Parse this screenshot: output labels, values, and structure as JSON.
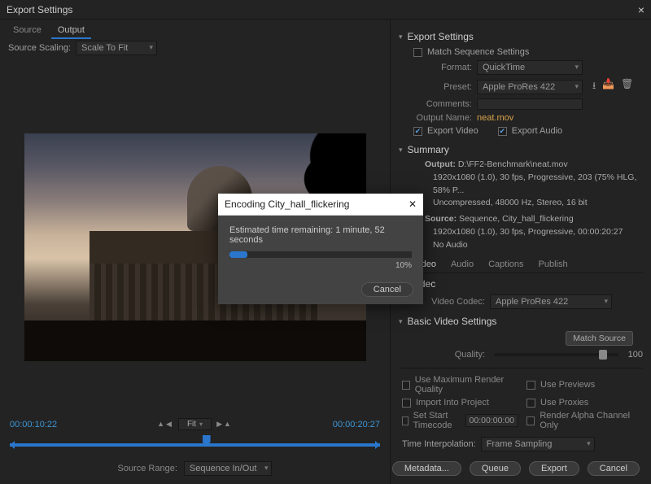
{
  "window": {
    "title": "Export Settings"
  },
  "left": {
    "tabs": [
      "Source",
      "Output"
    ],
    "active_tab": 1,
    "scaling_label": "Source Scaling:",
    "scaling_value": "Scale To Fit",
    "time_in": "00:00:10:22",
    "time_out": "00:00:20:27",
    "fit_label": "Fit",
    "source_range_label": "Source Range:",
    "source_range_value": "Sequence In/Out"
  },
  "export": {
    "heading": "Export Settings",
    "match_seq": "Match Sequence Settings",
    "format_label": "Format:",
    "format_value": "QuickTime",
    "preset_label": "Preset:",
    "preset_value": "Apple ProRes 422",
    "comments_label": "Comments:",
    "outputname_label": "Output Name:",
    "outputname_value": "neat.mov",
    "export_video": "Export Video",
    "export_audio": "Export Audio"
  },
  "summary": {
    "heading": "Summary",
    "output_label": "Output:",
    "output_path": "D:\\FF2-Benchmark\\neat.mov",
    "output_line2": "1920x1080 (1.0), 30 fps, Progressive, 203 (75% HLG, 58% P...",
    "output_line3": "Uncompressed, 48000 Hz, Stereo, 16 bit",
    "source_label": "Source:",
    "source_line1": "Sequence, City_hall_flickering",
    "source_line2": "1920x1080 (1.0), 30 fps, Progressive, 00:00:20:27",
    "source_line3": "No Audio"
  },
  "subtabs": {
    "items": [
      "Video",
      "Audio",
      "Captions",
      "Publish"
    ],
    "active": 0
  },
  "codec": {
    "heading": "Codec",
    "label": "Video Codec:",
    "value": "Apple ProRes 422"
  },
  "basic": {
    "heading": "Basic Video Settings",
    "match_source": "Match Source",
    "quality_label": "Quality:",
    "quality_value": "100"
  },
  "checks": {
    "max_render": "Use Maximum Render Quality",
    "previews": "Use Previews",
    "import_proj": "Import Into Project",
    "proxies": "Use Proxies",
    "start_tc": "Set Start Timecode",
    "start_tc_val": "00:00:00:00",
    "alpha": "Render Alpha Channel Only"
  },
  "interp": {
    "label": "Time Interpolation:",
    "value": "Frame Sampling"
  },
  "buttons": {
    "metadata": "Metadata...",
    "queue": "Queue",
    "export": "Export",
    "cancel": "Cancel"
  },
  "modal": {
    "title": "Encoding City_hall_flickering",
    "time_label": "Estimated time remaining: 1 minute, 52 seconds",
    "percent": "10%",
    "percent_num": 10,
    "cancel": "Cancel"
  }
}
